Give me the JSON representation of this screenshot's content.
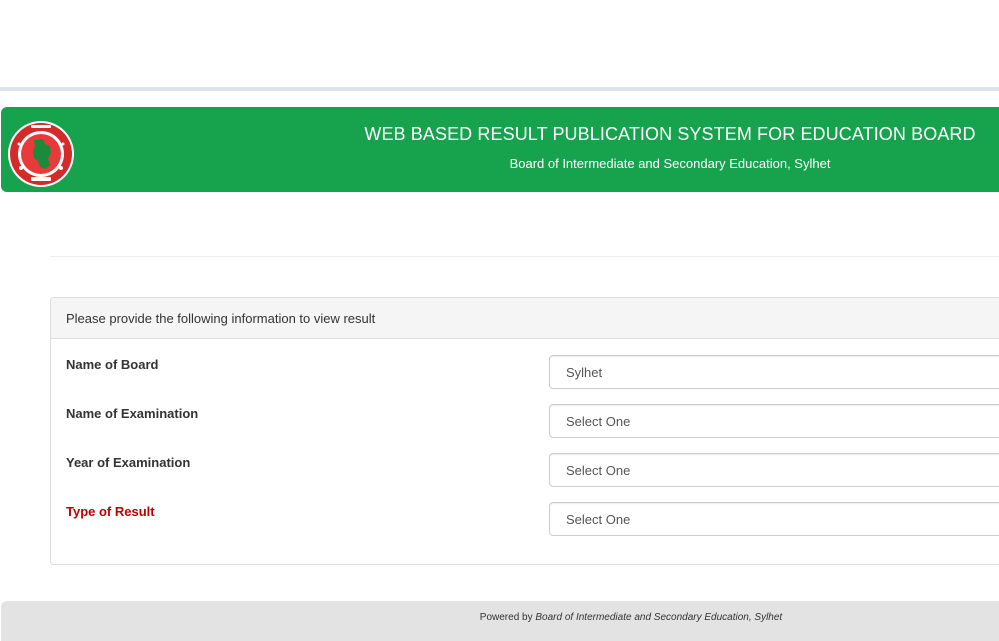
{
  "header": {
    "title": "WEB BASED RESULT PUBLICATION SYSTEM FOR EDUCATION BOARD",
    "subtitle": "Board of Intermediate and Secondary Education, Sylhet",
    "logo_icon": "bangladesh-government-seal-icon",
    "bg_color": "#17a24e"
  },
  "form": {
    "panel_heading": "Please provide the following information to view result",
    "fields": [
      {
        "label": "Name of Board",
        "value": "Sylhet"
      },
      {
        "label": "Name of Examination",
        "value": "Select One"
      },
      {
        "label": "Year of Examination",
        "value": "Select One"
      },
      {
        "label": "Type of Result",
        "value": "Select One",
        "label_color": "#c00000"
      }
    ]
  },
  "footer": {
    "prefix": "Powered by",
    "org": "Board of Intermediate and Secondary Education, Sylhet"
  }
}
